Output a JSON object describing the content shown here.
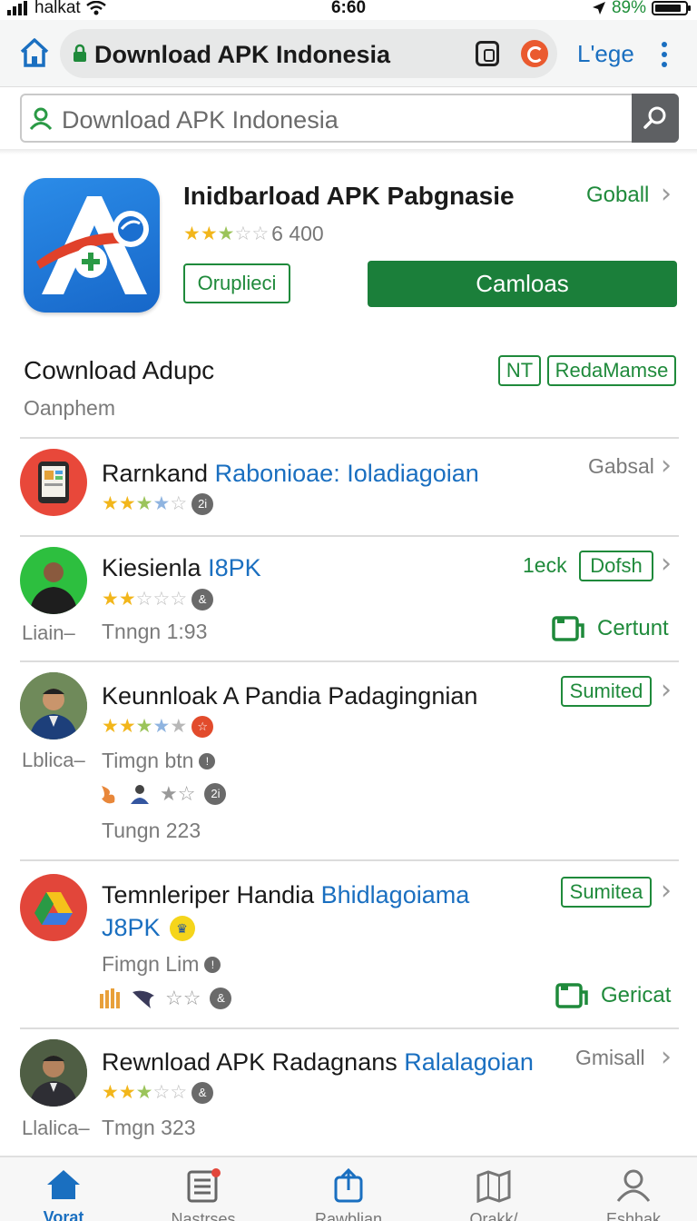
{
  "status_bar": {
    "carrier": "halkat",
    "time": "6:60",
    "battery": "89%"
  },
  "browser": {
    "url": "Download APK Indonesia",
    "lege_label": "L'ege"
  },
  "search": {
    "placeholder": "Download APK Indonesia"
  },
  "hero": {
    "title": "Inidbarload APK Pabgnasie",
    "rating_count": "6 400",
    "rating": 2.5,
    "global_label": "Goball",
    "outline_button": "Oruplieci",
    "primary_button": "Camloas"
  },
  "section": {
    "title": "Cownload Adupc",
    "subtitle": "Oanphem",
    "tag_nt": "NT",
    "tag_more": "RedaMamse"
  },
  "rows": [
    {
      "title_plain": "Rarnkand ",
      "title_blue": "Rabonioae: Ioladiagoian",
      "right_label": "Gabsal",
      "rating": 4,
      "badge": "2i"
    },
    {
      "title_plain": "Kiesienla ",
      "title_blue": "I8PK",
      "right_label": "1eck",
      "right_tag": "Dofsh",
      "rating": 2,
      "badge": "&",
      "left_label": "Liain–",
      "meta": "Tnngn 1:93",
      "action": "Certunt"
    },
    {
      "title_plain": "Keunnloak A Pandia Padagingnian",
      "title_blue": "",
      "right_tag": "Sumited",
      "rating": 5,
      "badge": "☆",
      "left_label": "Lblica–",
      "meta": "Timgn btn",
      "meta_badge": "!",
      "extra_badge": "2i",
      "meta2": "Tungn 223"
    },
    {
      "title_plain": "Temnleriper Handia ",
      "title_blue": "Bhidlagoiama",
      "title_line2": "J8PK",
      "right_tag": "Sumitea",
      "meta": "Fimgn Lim",
      "meta_badge": "!",
      "extra_badge": "&",
      "action": "Gericat"
    },
    {
      "title_plain": "Rewnload APK Radagnans ",
      "title_blue": "Ralalagoian",
      "right_label": "Gmisall",
      "rating": 3,
      "badge": "&",
      "left_label": "Llalica–",
      "meta": "Tmgn 323"
    }
  ],
  "tabbar": [
    {
      "label": "Vorat",
      "icon": "home-icon"
    },
    {
      "label": "Nastrses",
      "icon": "list-icon"
    },
    {
      "label": "Rawblian",
      "icon": "share-icon"
    },
    {
      "label": "Orakk/",
      "icon": "map-icon"
    },
    {
      "label": "Eshhak",
      "icon": "profile-icon"
    }
  ],
  "colors": {
    "accent_green": "#1f8a3b",
    "accent_blue": "#1a6fc0",
    "primary_button": "#1b7f3a"
  }
}
